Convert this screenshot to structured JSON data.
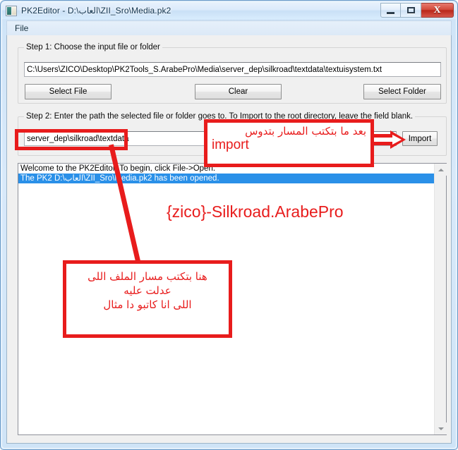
{
  "window": {
    "title": "PK2Editor - D:\\العاب\\ZII_Sro\\Media.pk2",
    "icon": "application-icon",
    "buttons": {
      "minimize": "–",
      "maximize": "□",
      "close": "X"
    }
  },
  "menubar": {
    "items": [
      {
        "label": "File"
      }
    ]
  },
  "step1": {
    "title": "Step 1: Choose the input file or folder",
    "path_value": "C:\\Users\\ZICO\\Desktop\\PK2Tools_S.ArabePro\\Media\\server_dep\\silkroad\\textdata\\textuisystem.txt",
    "path_placeholder": "",
    "buttons": {
      "select_file": "Select File",
      "clear": "Clear",
      "select_folder": "Select Folder"
    }
  },
  "step2": {
    "title": "Step 2: Enter the path the selected file or folder goes to. To Import to the root directory, leave the field blank.",
    "path_value": "server_dep\\silkroad\\textdata",
    "path_placeholder": "",
    "import_button": "Import"
  },
  "log": {
    "lines": [
      {
        "text": "Welcome to the PK2Editor. To begin, click File->Open.",
        "selected": false
      },
      {
        "text": "The PK2 D:\\العاب\\ZII_Sro\\Media.pk2 has been opened.",
        "selected": true
      }
    ],
    "scrollbar": {
      "up_arrow": "scroll-up-icon",
      "down_arrow": "scroll-down-icon"
    }
  },
  "annotations": {
    "watermark": "{zico}-Silkroad.ArabePro",
    "import_note_line1": "بعد ما بتكتب المسار بتدوس",
    "import_note_line2": "import",
    "path_note_line1": "هنا بتكتب مسار الملف اللى",
    "path_note_line2": "عدلت عليه",
    "path_note_line3": "اللى انا كاتبو دا مثال",
    "arrow_icon": "right-arrow-icon",
    "accent_color": "#e81c1c",
    "highlight_color": "#2a90e8"
  }
}
